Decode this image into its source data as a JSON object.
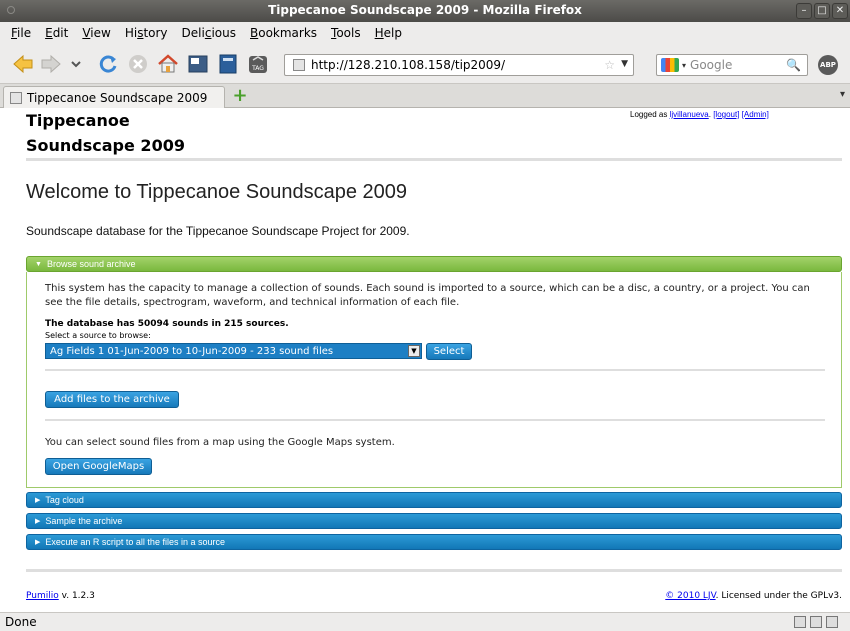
{
  "window": {
    "title": "Tippecanoe Soundscape 2009 - Mozilla Firefox"
  },
  "menu": [
    {
      "pre": "",
      "u": "F",
      "post": "ile"
    },
    {
      "pre": "",
      "u": "E",
      "post": "dit"
    },
    {
      "pre": "",
      "u": "V",
      "post": "iew"
    },
    {
      "pre": "Hi",
      "u": "s",
      "post": "tory"
    },
    {
      "pre": "Deli",
      "u": "c",
      "post": "ious"
    },
    {
      "pre": "",
      "u": "B",
      "post": "ookmarks"
    },
    {
      "pre": "",
      "u": "T",
      "post": "ools"
    },
    {
      "pre": "",
      "u": "H",
      "post": "elp"
    }
  ],
  "nav": {
    "url": "http://128.210.108.158/tip2009/",
    "search_placeholder": "Google",
    "abp": "ABP",
    "tag_label": "TAG"
  },
  "tabs": {
    "active": "Tippecanoe Soundscape 2009"
  },
  "page": {
    "site_title_line1": "Tippecanoe",
    "site_title_line2": "Soundscape 2009",
    "logged_as": "Logged as",
    "user": "ljvillanueva",
    "logout": "[logout]",
    "admin": "[Admin]",
    "heading": "Welcome to Tippecanoe Soundscape 2009",
    "intro": "Soundscape database for the Tippecanoe Soundscape Project for 2009.",
    "browse": {
      "title": "Browse sound archive",
      "description": "This system has the capacity to manage a collection of sounds. Each sound is imported to a source, which can be a disc, a country, or a project. You can see the file details, spectrogram, waveform, and technical information of each file.",
      "count": "The database has 50094 sounds in 215 sources.",
      "select_label": "Select a source to browse:",
      "selected_source": "Ag Fields 1 01-Jun-2009 to 10-Jun-2009 - 233 sound files",
      "select_button": "Select",
      "add_button": "Add files to the archive",
      "maps_text": "You can select sound files from a map using the Google Maps system.",
      "maps_button": "Open GoogleMaps"
    },
    "sections": [
      "Tag cloud",
      "Sample the archive",
      "Execute an R script to all the files in a source"
    ],
    "footer": {
      "app": "Pumilio",
      "version": " v. 1.2.3",
      "copyright": "© 2010 LJV",
      "license": ". Licensed under the GPLv3."
    }
  },
  "status": {
    "text": "Done"
  },
  "colors": {
    "green_header": "#7ab83e",
    "blue_header": "#1277b6"
  }
}
